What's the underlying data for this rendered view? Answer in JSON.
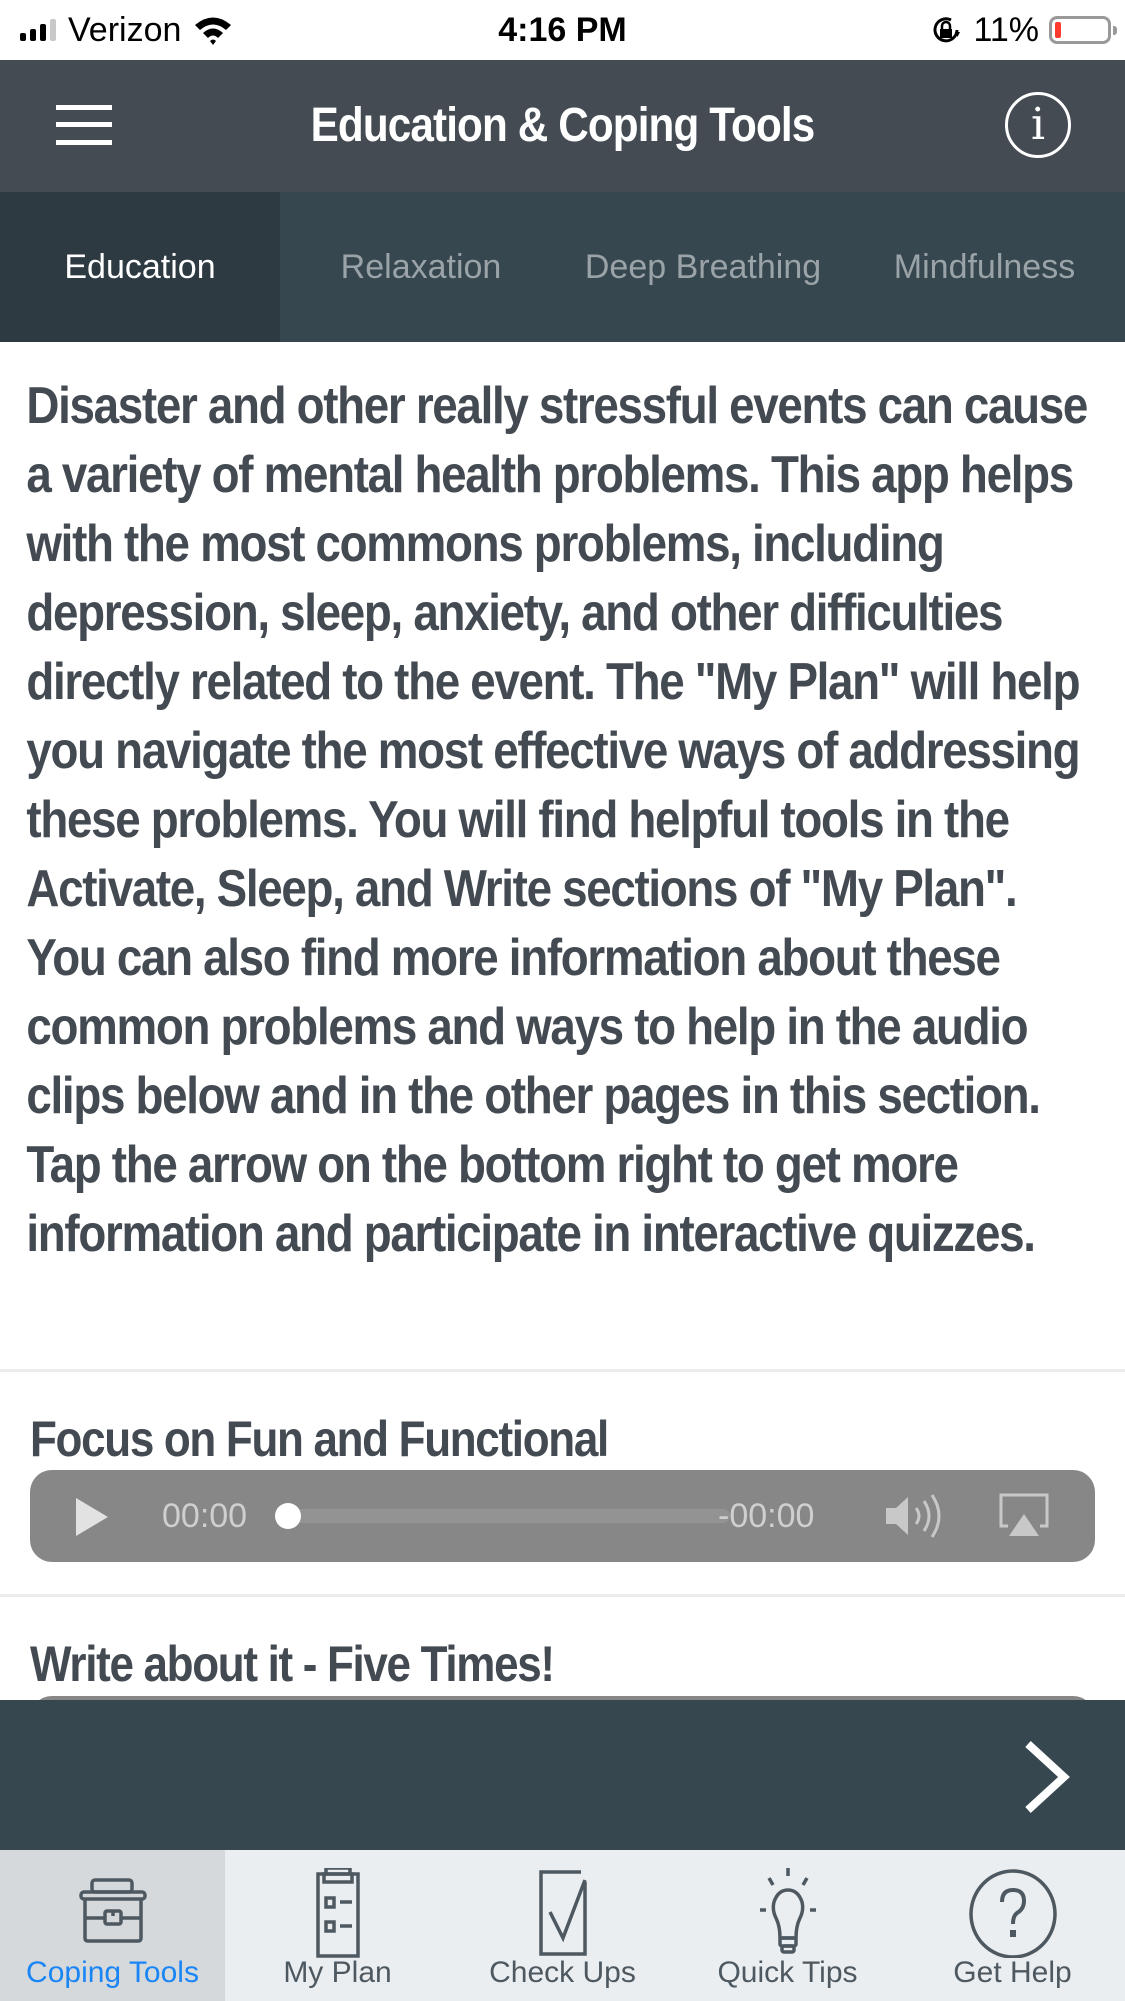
{
  "status_bar": {
    "carrier": "Verizon",
    "time": "4:16 PM",
    "battery_percent_label": "11%",
    "battery_level": 0.11,
    "battery_color": "#ff3b30",
    "signal_bars_active": 3,
    "signal_bars_total": 4
  },
  "header": {
    "title": "Education & Coping Tools",
    "menu_icon": "hamburger-menu-icon",
    "info_icon": "info-icon",
    "info_glyph": "i"
  },
  "tabs": [
    {
      "label": "Education",
      "active": true
    },
    {
      "label": "Relaxation",
      "active": false
    },
    {
      "label": "Deep Breathing",
      "active": false
    },
    {
      "label": "Mindfulness",
      "active": false
    }
  ],
  "content": {
    "intro": "Disaster and other really stressful events can cause a variety of mental health problems. This app helps with the most commons problems, including depression, sleep, anxiety, and other difficulties directly related to the event. The \"My Plan\" will help you navigate the most effective ways of addressing these problems. You will find helpful tools in the Activate, Sleep, and Write sections of \"My Plan\". You can also find more information about these common problems and ways to help in the audio clips below and in the other pages in this section. Tap the arrow on the bottom right to get more information and participate in interactive quizzes.",
    "audio_clips": [
      {
        "title": "Focus on Fun and Functional",
        "elapsed": "00:00",
        "remaining": "-00:00",
        "progress": 0
      },
      {
        "title": "Write about it - Five Times!"
      }
    ]
  },
  "next_bar": {
    "next_icon": "chevron-right-icon"
  },
  "tab_bar": {
    "active_color": "#1a85f5",
    "items": [
      {
        "label": "Coping Tools",
        "icon": "toolbox-icon",
        "active": true
      },
      {
        "label": "My Plan",
        "icon": "clipboard-checklist-icon",
        "active": false
      },
      {
        "label": "Check Ups",
        "icon": "checkbox-icon",
        "active": false
      },
      {
        "label": "Quick Tips",
        "icon": "lightbulb-icon",
        "active": false
      },
      {
        "label": "Get Help",
        "icon": "question-circle-icon",
        "active": false
      }
    ]
  }
}
